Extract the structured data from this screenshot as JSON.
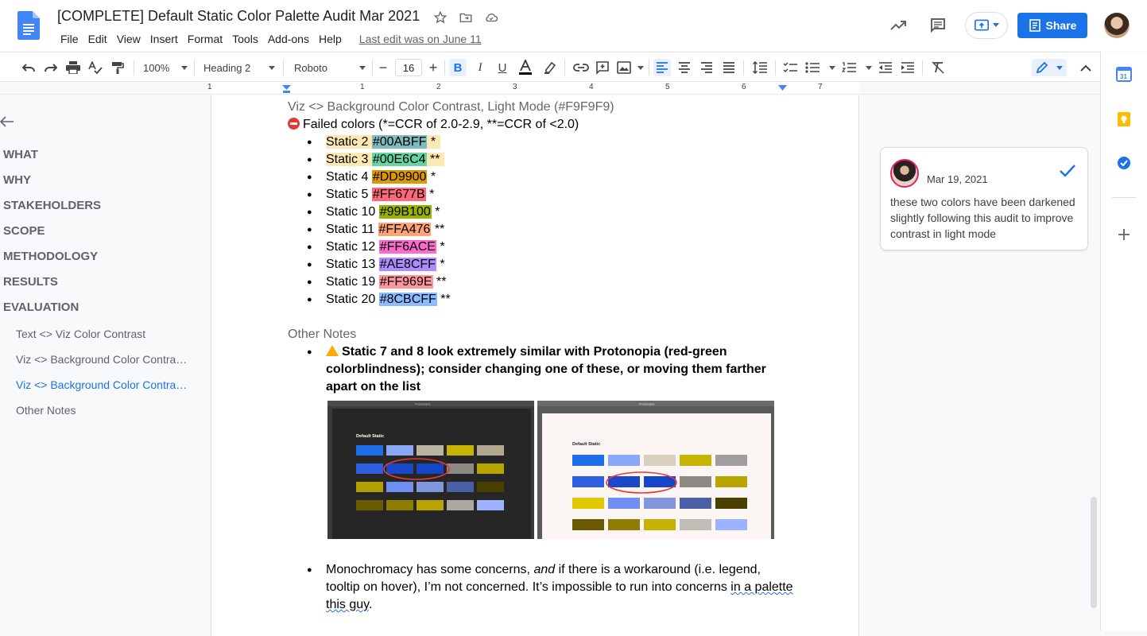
{
  "document": {
    "title": "[COMPLETE] Default Static Color Palette Audit Mar 2021",
    "last_edit": "Last edit was on June 11"
  },
  "menu": [
    "File",
    "Edit",
    "View",
    "Insert",
    "Format",
    "Tools",
    "Add-ons",
    "Help"
  ],
  "header": {
    "share_label": "Share"
  },
  "toolbar": {
    "zoom": "100%",
    "style": "Heading 2",
    "font": "Roboto",
    "font_size": "16"
  },
  "ruler": {
    "numbers": [
      "1",
      "1",
      "2",
      "3",
      "4",
      "5",
      "6",
      "7"
    ]
  },
  "outline": {
    "headings": [
      "WHAT",
      "WHY",
      "STAKEHOLDERS",
      "SCOPE",
      "METHODOLOGY",
      "RESULTS",
      "EVALUATION"
    ],
    "subheadings": [
      {
        "label": "Text <> Viz Color Contrast",
        "active": false
      },
      {
        "label": "Viz <> Background Color Contra…",
        "active": false
      },
      {
        "label": "Viz <> Background Color Contra…",
        "active": true
      },
      {
        "label": "Other Notes",
        "active": false
      }
    ]
  },
  "content": {
    "heading_light_mode": "Viz <> Background Color Contrast, Light Mode (#F9F9F9)",
    "failed_colors": "Failed colors (*=CCR of 2.0-2.9, **=CCR of <2.0)",
    "colors": [
      {
        "name": "Static 2",
        "hex": "#00ABFF",
        "mark": "*",
        "bg": "#7fbcbf",
        "row_hl": true
      },
      {
        "name": "Static 3",
        "hex": "#00E6C4",
        "mark": "**",
        "bg": "#66d3a4",
        "row_hl": true
      },
      {
        "name": "Static 4",
        "hex": "#DD9900",
        "mark": "*",
        "bg": "#dd9900",
        "row_hl": false
      },
      {
        "name": "Static 5",
        "hex": "#FF677B",
        "mark": "*",
        "bg": "#ff677b",
        "row_hl": false
      },
      {
        "name": "Static 10",
        "hex": "#99B100",
        "mark": "*",
        "bg": "#99b100",
        "row_hl": false
      },
      {
        "name": "Static 11",
        "hex": "#FFA476",
        "mark": "**",
        "bg": "#ffa476",
        "row_hl": false
      },
      {
        "name": "Static 12",
        "hex": "#FF6ACE",
        "mark": "*",
        "bg": "#ff6ace",
        "row_hl": false
      },
      {
        "name": "Static 13",
        "hex": "#AE8CFF",
        "mark": "*",
        "bg": "#ae8cff",
        "row_hl": false
      },
      {
        "name": "Static 19",
        "hex": "#FF969E",
        "mark": "**",
        "bg": "#ff969e",
        "row_hl": false
      },
      {
        "name": "Static 20",
        "hex": "#8CBCFF",
        "mark": "**",
        "bg": "#8cbcff",
        "row_hl": false
      }
    ],
    "other_notes_heading": "Other Notes",
    "note1": "Static 7 and 8 look extremely similar with Protonopia (red-green colorblindness); consider changing one of these, or moving them farther apart on the list",
    "note2_a": "Monochromacy has some concerns, ",
    "note2_em": "and",
    "note2_b": " if there is a workaround (i.e. legend, tooltip on hover), I’m not concerned. It’s impossible to run into concerns ",
    "note2_c": "in a palette this guy",
    "note2_d": ".",
    "screenshot_dark": {
      "header": "Protanopia",
      "heading": "Default Static"
    },
    "screenshot_light": {
      "header": "Protanopia",
      "heading": "Default Static"
    }
  },
  "comment": {
    "date": "Mar 19, 2021",
    "text": "these two colors have been darkened slightly following this audit to improve contrast in light mode"
  },
  "colors": {
    "accent": "#1a73e8",
    "highlight_row": "#fce8b2"
  }
}
